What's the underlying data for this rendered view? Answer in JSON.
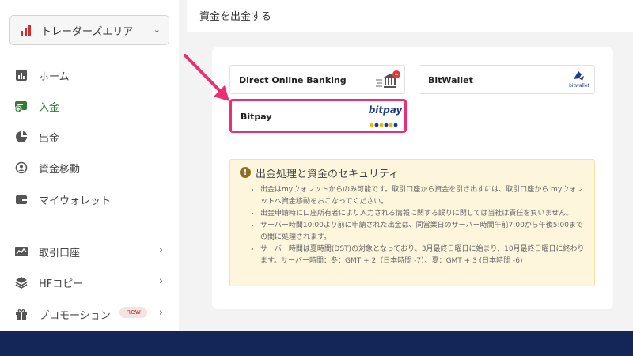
{
  "sidebar": {
    "account": {
      "label": "トレーダーズエリア"
    },
    "items": [
      {
        "label": "ホーム"
      },
      {
        "label": "入金"
      },
      {
        "label": "出金"
      },
      {
        "label": "資金移動"
      },
      {
        "label": "マイウォレット"
      },
      {
        "label": "取引口座"
      },
      {
        "label": "HFコピー"
      },
      {
        "label": "プロモーション",
        "badge": "new"
      }
    ]
  },
  "header": {
    "title": "資金を出金する"
  },
  "methods": [
    {
      "name": "Direct Online Banking"
    },
    {
      "name": "BitWallet",
      "logo_text": "bitwallet"
    },
    {
      "name": "Bitpay",
      "logo_text": "bitpay"
    }
  ],
  "notice": {
    "title": "出金処理と資金のセキュリティ",
    "items": [
      "出金はmyウォレットからのみ可能です。取引口座から資金を引き出すには、取引口座から myウォレットへ資金移動をおこなってください。",
      "出金申請時に口座所有者により入力される情報に関する誤りに関しては当社は責任を負いません。",
      "サーバー時間10:00より前に申請された出金は、同営業日のサーバー時間午前7:00から午後5:00までの間に処理されます。",
      "サーバー時間は夏時間(DST)の対象となっており、3月最終日曜日に始まり、10月最終日曜日に終わります。サーバー時間：冬：GMT + 2（日本時間 -7）、夏：GMT + 3 (日本時間 -6)"
    ]
  },
  "colors": {
    "accent_red": "#d42b2b",
    "active_green": "#2e7d32",
    "highlight_pink": "#ec2f74",
    "footer_navy": "#142658",
    "notice_bg": "#fdf6dc"
  }
}
